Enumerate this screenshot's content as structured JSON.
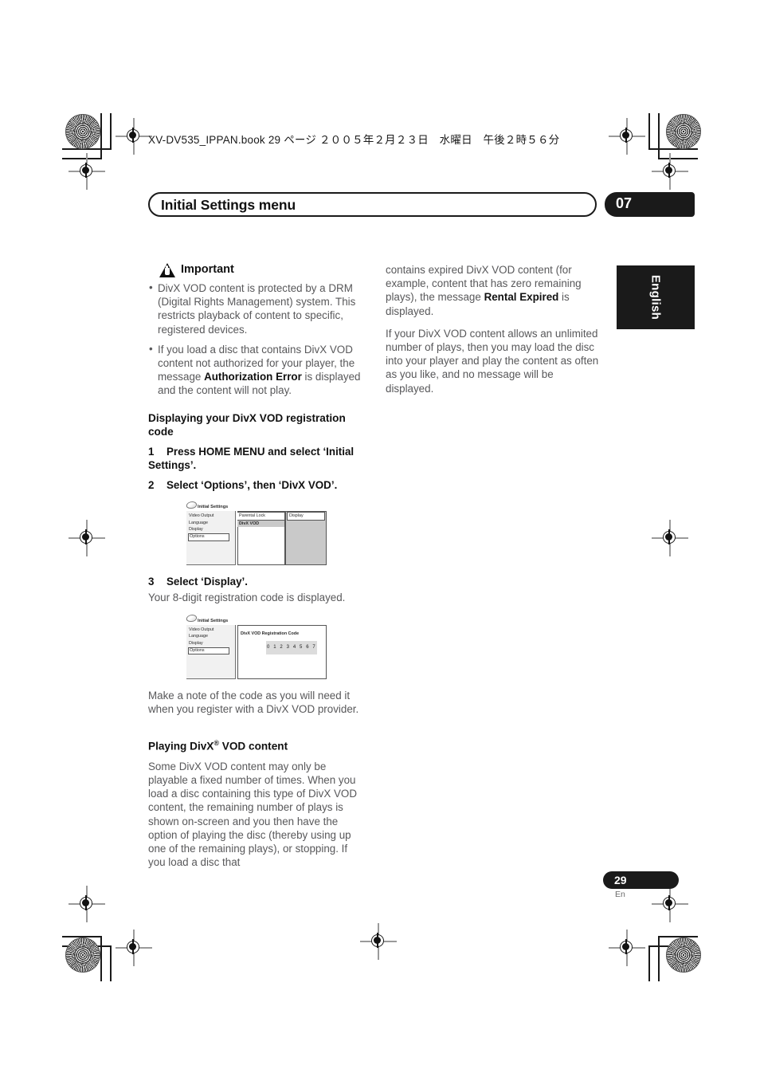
{
  "document": {
    "file_header": "XV-DV535_IPPAN.book  29 ページ  ２００５年２月２３日　水曜日　午後２時５６分",
    "chapter_title": "Initial Settings menu",
    "chapter_number": "07",
    "language_tab": "English",
    "page_number": "29",
    "page_number_suffix": "En"
  },
  "left_column": {
    "important": {
      "icon": "warning-triangle-icon",
      "title": "Important",
      "bullets": [
        "DivX VOD content is protected by a DRM (Digital Rights Management) system. This restricts playback of content to specific, registered devices.",
        "If you load a disc that contains DivX VOD content not authorized for your player, the message Authorization Error is displayed and the content will not play."
      ],
      "bullet2_pre": "If you load a disc that contains DivX VOD content not authorized for your player, the message ",
      "bullet2_bold": "Authorization Error",
      "bullet2_post": " is displayed and the content will not play.",
      "bullet1_text": "DivX VOD content is protected by a DRM (Digital Rights Management) system. This restricts playback of content to specific, registered devices."
    },
    "section1_heading": "Displaying your DivX VOD registration code",
    "step1_num": "1",
    "step1_text": "Press HOME MENU and select ‘Initial Settings’.",
    "step2_num": "2",
    "step2_text": "Select ‘Options’, then ‘DivX VOD’.",
    "step3_num": "3",
    "step3_text": "Select ‘Display’.",
    "step3_note": "Your 8-digit registration code is displayed.",
    "note_after_code": "Make a note of the code as you will need it when you register with a DivX VOD provider.",
    "section2_heading_pre": "Playing DivX",
    "section2_heading_sup": "®",
    "section2_heading_post": " VOD content",
    "section2_body": "Some DivX VOD content may only be playable a fixed number of times. When you load a disc containing this type of DivX VOD content, the remaining number of plays is shown on-screen and you then have the option of playing the disc (thereby using up one of the remaining plays), or stopping. If you load a disc that"
  },
  "right_column": {
    "para1_pre": "contains expired DivX VOD content (for example, content that has zero remaining plays), the message ",
    "para1_bold": "Rental Expired",
    "para1_post": " is displayed.",
    "para2": "If your DivX VOD content allows an unlimited number of plays, then you may load the disc into your player and play the content as often as you like, and no message will be displayed."
  },
  "osd_screen_1": {
    "title": "Initial Settings",
    "left_items": [
      "Video Output",
      "Language",
      "Display"
    ],
    "left_selected": "Options",
    "mid_items": [
      "Parental Lock",
      "DivX VOD"
    ],
    "mid_highlighted": "DivX VOD",
    "right_label": "Display"
  },
  "osd_screen_2": {
    "title": "Initial Settings",
    "left_items": [
      "Video Output",
      "Language",
      "Display"
    ],
    "left_selected": "Options",
    "panel_title": "DivX VOD Registration Code",
    "registration_code": "0 1 2 3 4 5 6 7"
  },
  "colors": {
    "ink_black": "#1a1a1a",
    "body_gray": "#58585a",
    "osd_highlight": "#c9c9c9",
    "osd_panel": "#f1f1f1"
  }
}
